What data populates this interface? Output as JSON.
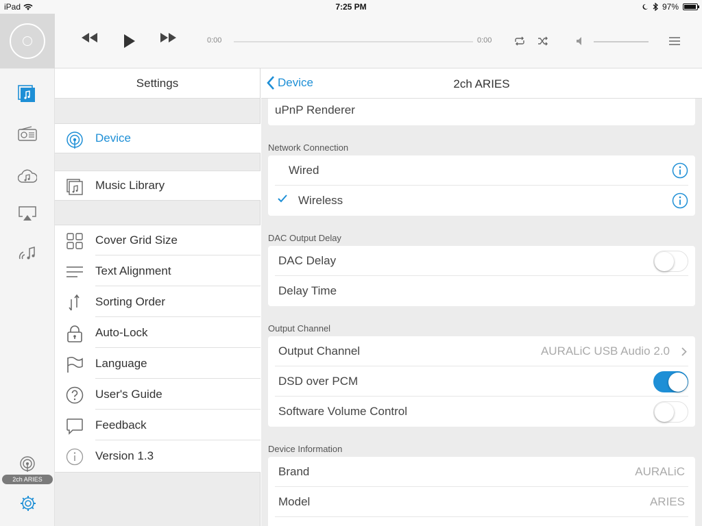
{
  "status_bar": {
    "carrier": "iPad",
    "time": "7:25 PM",
    "battery": "97%",
    "battery_level": 0.97
  },
  "player": {
    "elapsed": "0:00",
    "remaining": "0:00",
    "progress": 0,
    "icons": [
      "disc-icon",
      "rewind-icon",
      "play-icon",
      "fast-forward-icon",
      "repeat-icon",
      "shuffle-icon",
      "volume-icon",
      "menu-icon"
    ]
  },
  "rail": {
    "icons": [
      "music-library-icon",
      "radio-icon",
      "cloud-music-icon",
      "airplay-icon",
      "streaming-icon",
      "device-icon",
      "settings-gear-icon"
    ],
    "device_badge": "2ch ARIES",
    "accent": "#1e8fd6"
  },
  "settings": {
    "title": "Settings",
    "device": "Device",
    "music_library": "Music Library",
    "items": [
      {
        "label": "Cover Grid Size",
        "icon": "grid-icon"
      },
      {
        "label": "Text Alignment",
        "icon": "align-icon"
      },
      {
        "label": "Sorting Order",
        "icon": "sort-icon"
      },
      {
        "label": "Auto-Lock",
        "icon": "lock-icon"
      },
      {
        "label": "Language",
        "icon": "flag-icon"
      },
      {
        "label": "User's Guide",
        "icon": "help-icon"
      },
      {
        "label": "Feedback",
        "icon": "speech-bubble-icon"
      },
      {
        "label": "Version 1.3",
        "icon": "info-icon"
      }
    ]
  },
  "detail": {
    "back_label": "Device",
    "title": "2ch ARIES",
    "upnp": "uPnP Renderer",
    "network_header": "Network Connection",
    "wired": "Wired",
    "wireless": "Wireless",
    "dac_header": "DAC Output Delay",
    "dac_delay": "DAC Delay",
    "dac_delay_on": false,
    "delay_time": "Delay Time",
    "output_header": "Output Channel",
    "output_channel": "Output Channel",
    "output_channel_value": "AURALiC USB Audio 2.0",
    "dsd_over_pcm": "DSD over PCM",
    "dsd_over_pcm_on": true,
    "software_volume": "Software Volume Control",
    "software_volume_on": false,
    "device_info_header": "Device Information",
    "brand": "Brand",
    "brand_value": "AURALiC",
    "model": "Model",
    "model_value": "ARIES"
  }
}
